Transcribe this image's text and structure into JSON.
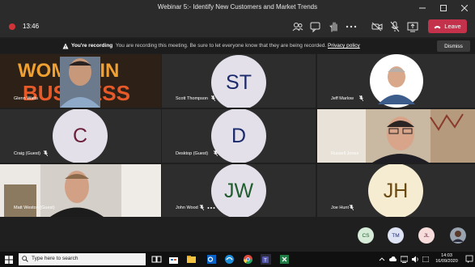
{
  "window": {
    "title": "Webinar 5:- Identify New Customers and Market Trends"
  },
  "toolbar": {
    "timer": "13:46",
    "leave_label": "Leave"
  },
  "banner": {
    "heading": "You're recording",
    "message": "You are recording this meeting. Be sure to let everyone know that they are being recorded.",
    "link": "Privacy policy",
    "dismiss_label": "Dismiss"
  },
  "tiles": [
    {
      "name": "Glenn Watts",
      "initials": ""
    },
    {
      "name": "Scott Thompson",
      "initials": "ST"
    },
    {
      "name": "Jeff Marlow",
      "initials": ""
    },
    {
      "name": "Craig (Guest)",
      "initials": "C"
    },
    {
      "name": "Desktop (Guest)",
      "initials": "D"
    },
    {
      "name": "Russell Jones",
      "initials": ""
    },
    {
      "name": "Matt Weston (Guest)",
      "initials": ""
    },
    {
      "name": "John Wood",
      "initials": "JW"
    },
    {
      "name": "Joe Hunt",
      "initials": "JH"
    }
  ],
  "backdrop_text": {
    "line1": "WOMEN IN",
    "line2": "BUSINESS"
  },
  "strip": {
    "avatars": [
      "CS",
      "TM",
      "JL"
    ]
  },
  "taskbar": {
    "search_placeholder": "Type here to search",
    "time": "14:03",
    "date": "16/09/2020"
  },
  "colors": {
    "leave": "#c4314b",
    "recording": "#d13438",
    "avatar_bg": "#e0dce8",
    "avatar_text_purple": "#6b1f3a",
    "avatar_text_blue": "#1b2a6b",
    "avatar_text_green": "#1f5c2e",
    "avatar_text_gold": "#6b4a12"
  }
}
